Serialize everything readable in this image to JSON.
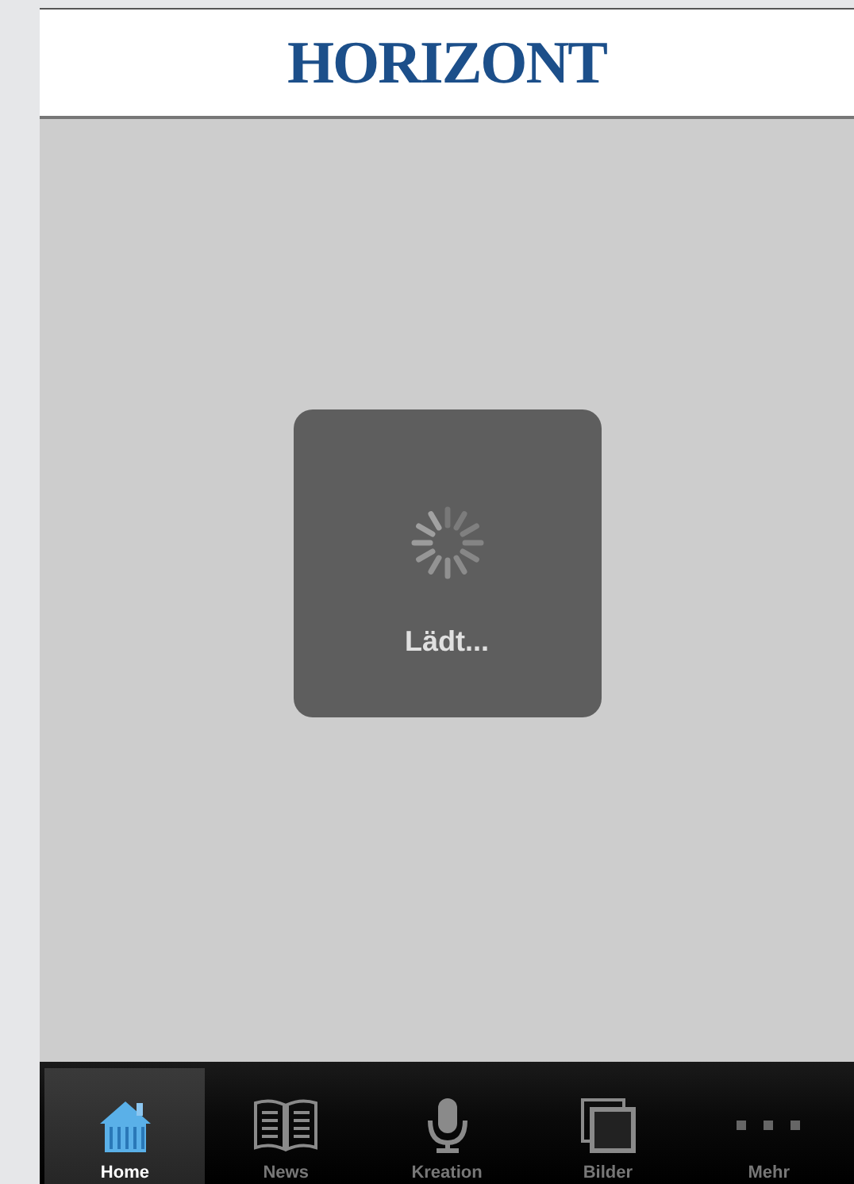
{
  "header": {
    "logo": "HORIZONT"
  },
  "loading": {
    "label": "Lädt..."
  },
  "tab_bar": [
    {
      "label": "Home",
      "kind": "home",
      "selected": true
    },
    {
      "label": "News",
      "kind": "book",
      "selected": false
    },
    {
      "label": "Kreation",
      "kind": "mic",
      "selected": false
    },
    {
      "label": "Bilder",
      "kind": "photos",
      "selected": false
    },
    {
      "label": "Mehr",
      "kind": "more",
      "selected": false
    }
  ]
}
